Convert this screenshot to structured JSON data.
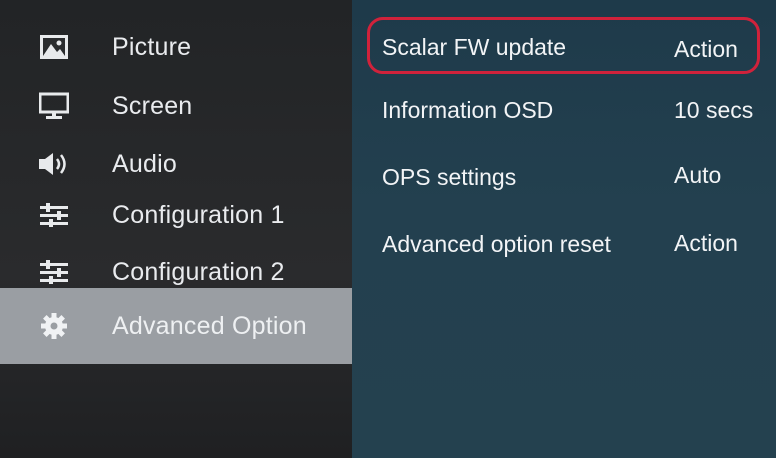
{
  "sidebar": {
    "items": [
      {
        "label": "Picture",
        "icon": "picture-icon"
      },
      {
        "label": "Screen",
        "icon": "monitor-icon"
      },
      {
        "label": "Audio",
        "icon": "speaker-icon"
      },
      {
        "label": "Configuration 1",
        "icon": "sliders-icon"
      },
      {
        "label": "Configuration 2",
        "icon": "sliders-icon"
      },
      {
        "label": "Advanced Option",
        "icon": "gear-icon",
        "selected": true
      }
    ]
  },
  "options": [
    {
      "label": "Scalar FW update",
      "value": "Action",
      "highlighted": true
    },
    {
      "label": "Information OSD",
      "value": "10 secs"
    },
    {
      "label": "OPS settings",
      "value": "Auto",
      "disabled": true
    },
    {
      "label": "Advanced option reset",
      "value": "Action"
    }
  ],
  "colors": {
    "highlight_outline": "#d0223b",
    "selected_item_bg": "#9a9ea3",
    "right_panel_bg": "#23404f",
    "disabled_text": "#6f8591"
  }
}
